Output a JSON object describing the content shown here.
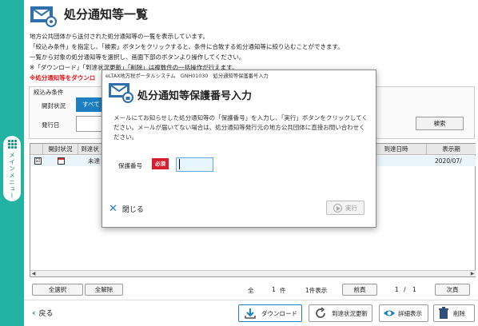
{
  "side_nav": {
    "label": "メインメニュー"
  },
  "header": {
    "title": "処分通知等一覧"
  },
  "descriptions": [
    "地方公共団体から送付された処分通知等の一覧を表示しています。",
    "「絞込み条件」を指定し、「検索」ボタンをクリックすると、条件に合致する処分通知等に絞り込むことができます。",
    "一覧から対象の処分通知等を選択し、画面下部のボタンより操作してください。",
    "※「ダウンロード」「到達状況更新」「削除」は複数件の一括操作が行えます。",
    "※処分通知等をダウンロ"
  ],
  "filter": {
    "legend": "絞込み条件",
    "open_status_label": "開封状況",
    "open_status_value": "すべて",
    "issue_date_label": "発行日",
    "search_label": "検索"
  },
  "table": {
    "columns": [
      "開封状況",
      "到達状",
      "到達日時",
      "表示期"
    ],
    "rows": [
      {
        "checked": "☑",
        "status": "未達",
        "display_until": "2020/07/"
      }
    ]
  },
  "bottom": {
    "select_all": "全選択",
    "deselect_all": "全解除",
    "total_prefix": "全",
    "total_count": "1",
    "total_unit": "件",
    "shown_count": "1件表示",
    "prev": "前頁",
    "page_current": "1",
    "page_sep": "/",
    "page_total": "1",
    "next": "次頁"
  },
  "footer": {
    "back": "戻る",
    "download": "ダウンロード",
    "refresh": "到達状況更新",
    "detail": "詳細表示",
    "delete": "削除"
  },
  "modal": {
    "system": "eLTAX地方税ポータルシステム　GNH01030　処分通知等保護番号入力",
    "title": "処分通知等保護番号入力",
    "description": "メールにてお知らせした処分通知等の「保護番号」を入力し、「実行」ボタンをクリックしてください。メールが届いてない場合は、処分通知等発行元の地方公共団体に直接お問い合わせください。",
    "field_label": "保護番号",
    "required_badge": "必須",
    "field_value": "",
    "close_label": "閉じる",
    "execute_label": "実行"
  },
  "colors": {
    "side": "#22b3a3",
    "accent": "#1d7fc2",
    "required": "#d81e2c",
    "warning": "#e0161b"
  }
}
